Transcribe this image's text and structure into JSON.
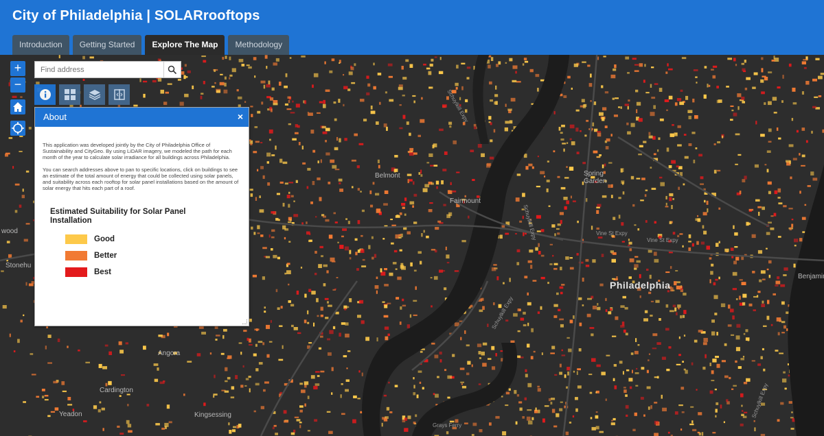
{
  "header": {
    "title": "City of Philadelphia | SOLARrooftops"
  },
  "tabs": [
    {
      "label": "Introduction",
      "active": false
    },
    {
      "label": "Getting Started",
      "active": false
    },
    {
      "label": "Explore The Map",
      "active": true
    },
    {
      "label": "Methodology",
      "active": false
    }
  ],
  "controls": {
    "zoom_in": "+",
    "zoom_out": "−"
  },
  "search": {
    "placeholder": "Find address",
    "value": ""
  },
  "tools": [
    {
      "name": "info-icon"
    },
    {
      "name": "basemap-gallery-icon"
    },
    {
      "name": "layers-icon"
    },
    {
      "name": "swipe-icon"
    }
  ],
  "about": {
    "title": "About",
    "close": "×",
    "para1": "This application was developed jointly by the City of Philadelphia Office of Sustainability and CityGeo.  By using LiDAR imagery, we modeled the path for each month of the year to calculate solar irradiance for all buildings across Philadelphia.",
    "para2": "You can search addresses above to pan to specific locations, click on buildings to see an estimate of the total amount of energy that could be collected using solar panels, and suitability across each rooftop for solar panel installations based on the amount of solar energy that hits each part of a roof.",
    "legend_title": "Estimated Suitability for Solar Panel Installation",
    "legend": [
      {
        "label": "Good",
        "color": "#fdc94a"
      },
      {
        "label": "Better",
        "color": "#f17a33"
      },
      {
        "label": "Best",
        "color": "#e31a1c"
      }
    ]
  },
  "map_labels": {
    "philadelphia": "Philadelphia",
    "belmont": "Belmont",
    "spring_garden": "Spring Garden",
    "fairmount": "Fairmount",
    "cardington": "Cardington",
    "yeadon": "Yeadon",
    "angora": "Angora",
    "kingsessing": "Kingsessing",
    "wood": "wood",
    "stonehurst": "Stonehu",
    "benjamin": "Benjamin",
    "vine_st_expy_1": "Vine St Expy",
    "vine_st_expy_2": "Vine St Expy",
    "schuylkill_expy_1": "Schuylkill Expy",
    "schuylkill_expy_2": "Schuylkill Expy",
    "schuylkill_expy_3": "Schuylkill Expy",
    "schuylkill_expy_4": "Schuylkill Expy",
    "grays_ferry": "Grays Ferry"
  },
  "colors": {
    "header": "#1f74d4",
    "map_bg": "#2d2d2d",
    "river": "#1a1a1a",
    "good": "#fdc94a",
    "better": "#f17a33",
    "best": "#e31a1c"
  }
}
